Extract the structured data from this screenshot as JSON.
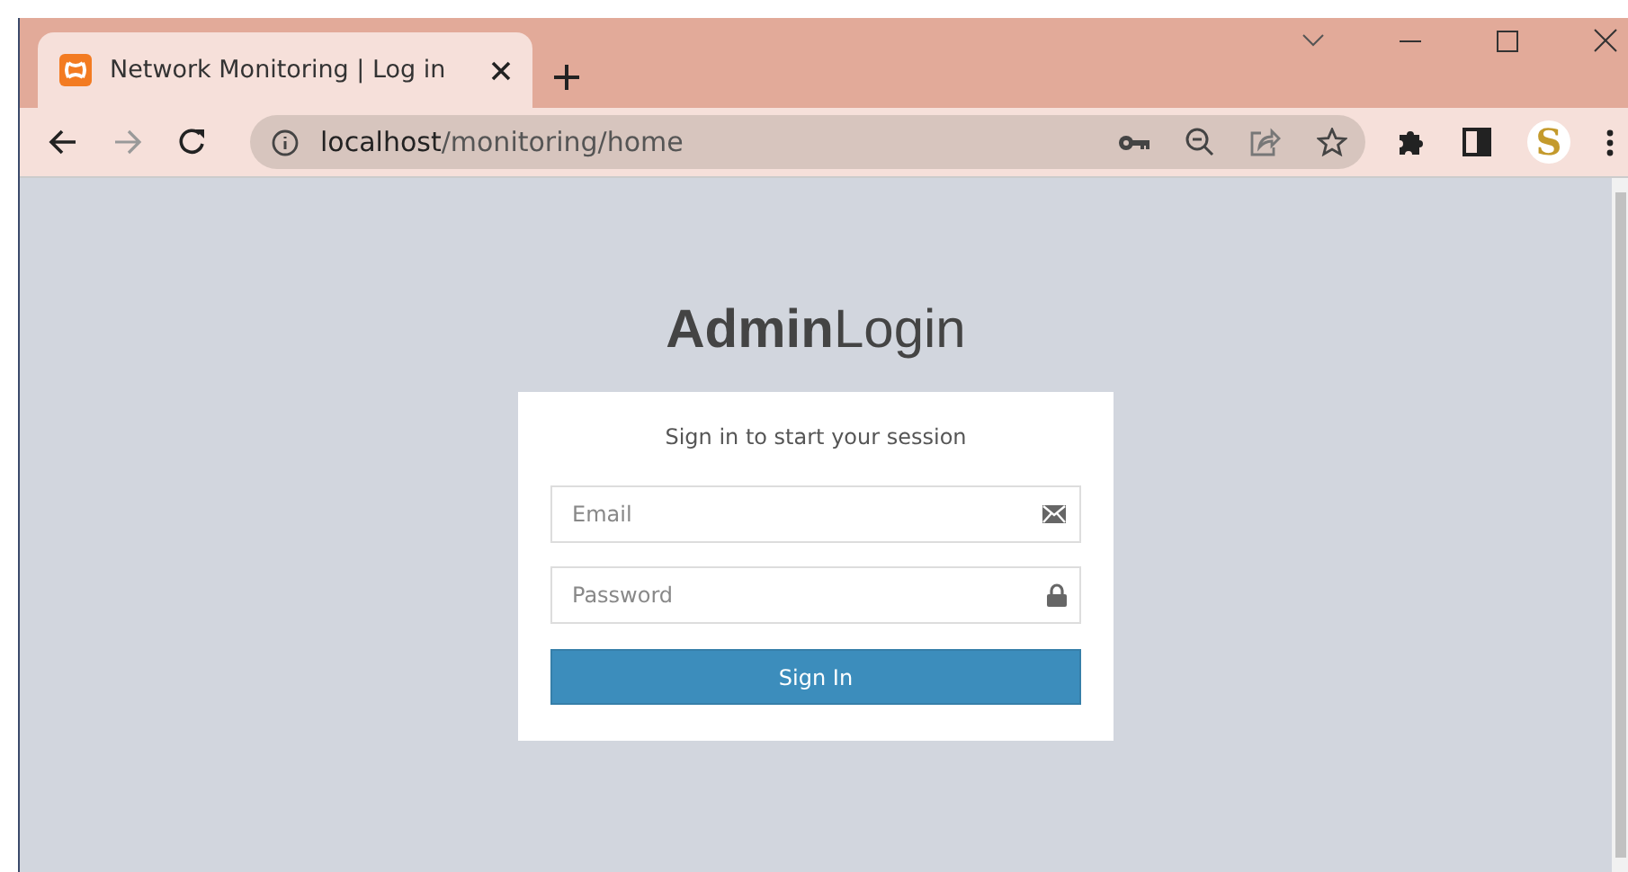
{
  "tab": {
    "title": "Network Monitoring | Log in",
    "selected": true
  },
  "address_bar": {
    "host": "localhost",
    "path": "/monitoring/home"
  },
  "profile": {
    "initial": "S"
  },
  "login": {
    "heading": "**Admin**Login",
    "message": "Sign in to start your session",
    "fields": [
      {
        "kind": "email",
        "placeholder": "Email"
      },
      {
        "kind": "password",
        "placeholder": "Password"
      }
    ],
    "button": "Sign In"
  }
}
